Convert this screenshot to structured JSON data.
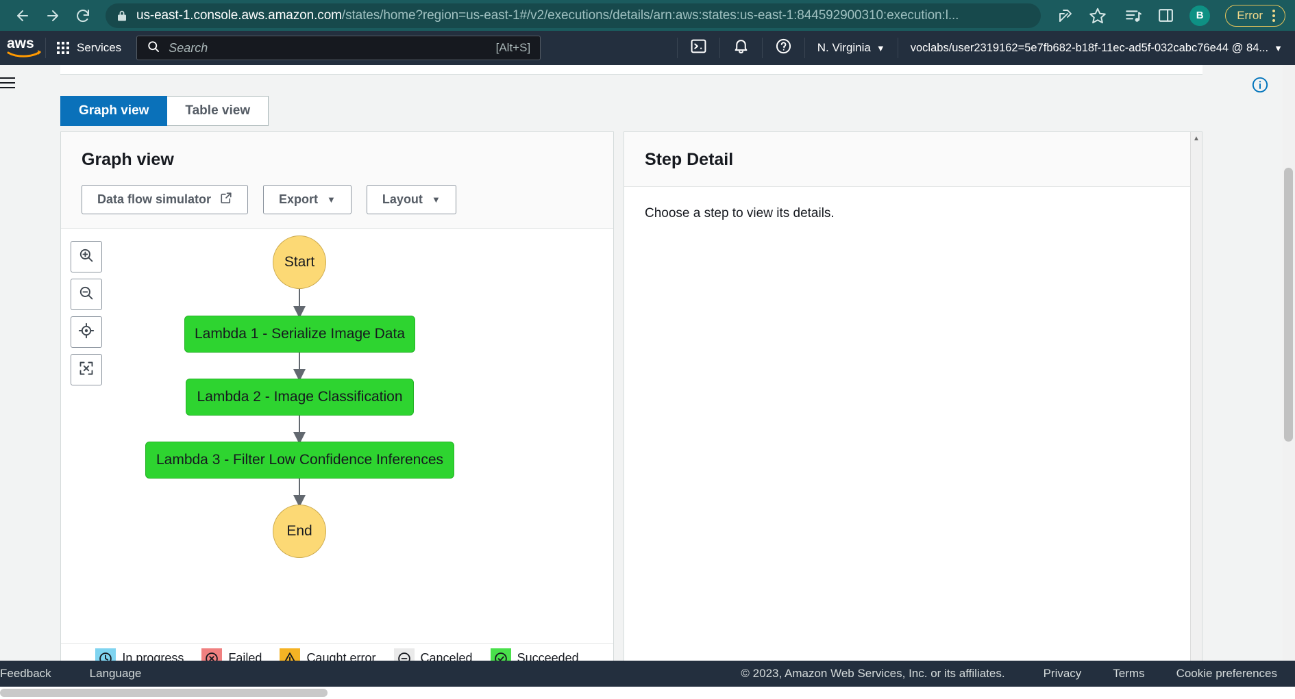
{
  "browser": {
    "back_icon": "arrow-left-icon",
    "forward_icon": "arrow-right-icon",
    "reload_icon": "reload-icon",
    "lock_icon": "lock-icon",
    "url_host": "us-east-1.console.aws.amazon.com",
    "url_path": "/states/home?region=us-east-1#/v2/executions/details/arn:aws:states:us-east-1:844592900310:execution:l...",
    "share_icon": "share-icon",
    "bookmark_icon": "star-icon",
    "reading_list_icon": "reading-list-icon",
    "sidepanel_icon": "side-panel-icon",
    "profile_initial": "B",
    "error_label": "Error",
    "menu_icon": "kebab-menu-icon"
  },
  "awsnav": {
    "logo": "aws-logo",
    "services_label": "Services",
    "services_icon": "grid-icon",
    "search": {
      "icon": "search-icon",
      "placeholder": "Search",
      "shortcut": "[Alt+S]"
    },
    "cloudshell_icon": "cloudshell-icon",
    "notifications_icon": "bell-icon",
    "help_icon": "question-mark-icon",
    "region_label": "N. Virginia",
    "account_label": "voclabs/user2319162=5e7fb682-b18f-11ec-ad5f-032cabc76e44 @ 84...",
    "caret": "▼"
  },
  "page": {
    "hamburger_icon": "hamburger-menu-icon",
    "info_icon": "info-circle-icon",
    "tabs": [
      {
        "label": "Graph view",
        "active": true
      },
      {
        "label": "Table view",
        "active": false
      }
    ]
  },
  "graph": {
    "title": "Graph view",
    "buttons": {
      "simulator": "Data flow simulator",
      "simulator_icon": "external-link-icon",
      "export": "Export",
      "layout": "Layout",
      "caret": "▼"
    },
    "zoom_controls": [
      {
        "name": "zoom-in-icon"
      },
      {
        "name": "zoom-out-icon"
      },
      {
        "name": "center-focus-icon"
      },
      {
        "name": "fullscreen-icon"
      }
    ],
    "nodes": [
      {
        "label": "Start",
        "type": "circle",
        "color": "#fcd975"
      },
      {
        "label": "Lambda 1 - Serialize Image Data",
        "type": "box",
        "color": "#2ed430"
      },
      {
        "label": "Lambda 2 - Image Classification",
        "type": "box",
        "color": "#2ed430"
      },
      {
        "label": "Lambda 3 - Filter Low Confidence Inferences",
        "type": "box",
        "color": "#2ed430"
      },
      {
        "label": "End",
        "type": "circle",
        "color": "#fcd975"
      }
    ],
    "legend": [
      {
        "label": "In progress",
        "icon": "clock-icon",
        "bg": "#7fd4f0"
      },
      {
        "label": "Failed",
        "icon": "x-circle-icon",
        "bg": "#f08080"
      },
      {
        "label": "Caught error",
        "icon": "warning-triangle-icon",
        "bg": "#f5b324"
      },
      {
        "label": "Canceled",
        "icon": "minus-circle-icon",
        "bg": "#eaeaea"
      },
      {
        "label": "Succeeded",
        "icon": "check-circle-icon",
        "bg": "#49e04b"
      }
    ]
  },
  "detail": {
    "title": "Step Detail",
    "empty_text": "Choose a step to view its details."
  },
  "footer": {
    "feedback": "Feedback",
    "language": "Language",
    "copyright": "© 2023, Amazon Web Services, Inc. or its affiliates.",
    "privacy": "Privacy",
    "terms": "Terms",
    "cookies": "Cookie preferences"
  }
}
